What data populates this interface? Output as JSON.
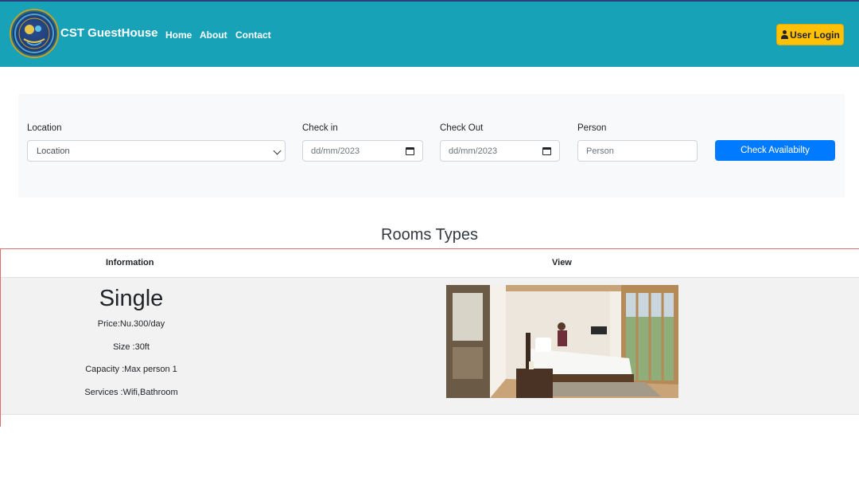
{
  "navbar": {
    "brand": "CST GuestHouse",
    "links": [
      "Home",
      "About",
      "Contact"
    ],
    "login_label": "User Login",
    "colors": {
      "background": "#17a2b8",
      "login_button": "#ffc107"
    }
  },
  "search": {
    "location": {
      "label": "Location",
      "value": "Location"
    },
    "check_in": {
      "label": "Check in",
      "value": "dd/mm/2023"
    },
    "check_out": {
      "label": "Check Out",
      "value": "dd/mm/2023"
    },
    "person": {
      "label": "Person",
      "placeholder": "Person"
    },
    "button_label": "Check Availabilty",
    "button_color": "#007bff"
  },
  "rooms": {
    "heading": "Rooms Types",
    "columns": [
      "Information",
      "View"
    ],
    "items": [
      {
        "name": "Single",
        "price": "Price:Nu.300/day",
        "size": "Size :30ft",
        "capacity": "Capacity :Max person 1",
        "services": "Services :Wifi,Bathroom"
      }
    ]
  }
}
